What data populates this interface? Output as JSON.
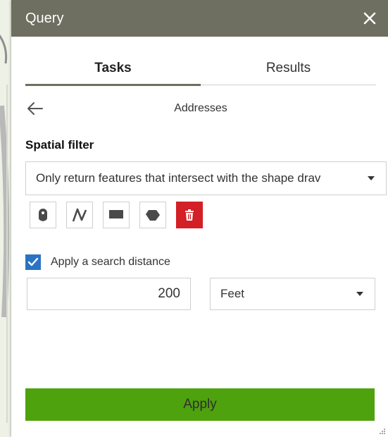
{
  "window": {
    "title": "Query",
    "close_icon": "close-icon"
  },
  "tabs": [
    {
      "label": "Tasks",
      "active": true
    },
    {
      "label": "Results",
      "active": false
    }
  ],
  "subheader": {
    "back_icon": "arrow-left-icon",
    "title": "Addresses"
  },
  "spatial_filter": {
    "label": "Spatial filter",
    "selected": "Only return features that intersect with the shape drav"
  },
  "draw_tools": [
    {
      "name": "point",
      "icon": "point-icon"
    },
    {
      "name": "polyline",
      "icon": "polyline-icon"
    },
    {
      "name": "rectangle",
      "icon": "rectangle-icon"
    },
    {
      "name": "polygon",
      "icon": "polygon-icon"
    },
    {
      "name": "clear",
      "icon": "trash-icon"
    }
  ],
  "search_distance": {
    "checked": true,
    "label": "Apply a search distance",
    "value": "200",
    "unit": "Feet"
  },
  "apply_button": {
    "label": "Apply"
  },
  "colors": {
    "header_bg": "#6e6e61",
    "apply_green": "#4ea20d",
    "clear_red": "#d31f26",
    "checkbox_blue": "#2a73c4"
  }
}
